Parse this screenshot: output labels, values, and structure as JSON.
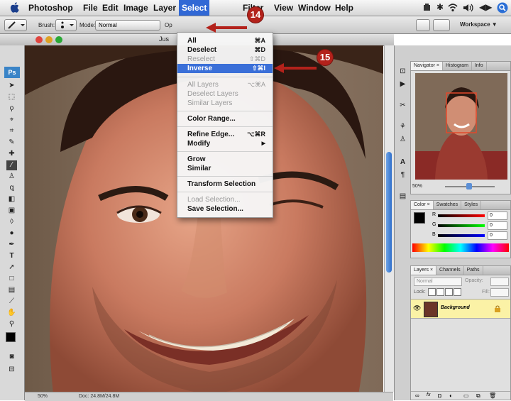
{
  "menubar": {
    "app_name": "Photoshop",
    "items": [
      "File",
      "Edit",
      "Image",
      "Layer",
      "Select",
      "Filter",
      "View",
      "Window",
      "Help"
    ]
  },
  "options_bar": {
    "brush_label": "Brush:",
    "mode_label": "Mode:",
    "mode_value": "Normal",
    "opacity_label": "Op",
    "workspace_label": "Workspace ▼"
  },
  "document": {
    "title": "Jus"
  },
  "select_menu": {
    "items": [
      {
        "label": "All",
        "shortcut": "⌘A",
        "disabled": false,
        "highlighted": false
      },
      {
        "label": "Deselect",
        "shortcut": "⌘D",
        "disabled": false,
        "highlighted": false
      },
      {
        "label": "Reselect",
        "shortcut": "⇧⌘D",
        "disabled": true,
        "highlighted": false
      },
      {
        "label": "Inverse",
        "shortcut": "⇧⌘I",
        "disabled": false,
        "highlighted": true
      },
      {
        "label": "All Layers",
        "shortcut": "⌥⌘A",
        "disabled": true,
        "highlighted": false
      },
      {
        "label": "Deselect Layers",
        "shortcut": "",
        "disabled": true,
        "highlighted": false
      },
      {
        "label": "Similar Layers",
        "shortcut": "",
        "disabled": true,
        "highlighted": false
      },
      {
        "label": "Color Range...",
        "shortcut": "",
        "disabled": false,
        "highlighted": false
      },
      {
        "label": "Refine Edge...",
        "shortcut": "⌥⌘R",
        "disabled": false,
        "highlighted": false
      },
      {
        "label": "Modify",
        "shortcut": "▶",
        "disabled": false,
        "highlighted": false
      },
      {
        "label": "Grow",
        "shortcut": "",
        "disabled": false,
        "highlighted": false
      },
      {
        "label": "Similar",
        "shortcut": "",
        "disabled": false,
        "highlighted": false
      },
      {
        "label": "Transform Selection",
        "shortcut": "",
        "disabled": false,
        "highlighted": false
      },
      {
        "label": "Load Selection...",
        "shortcut": "",
        "disabled": true,
        "highlighted": false
      },
      {
        "label": "Save Selection...",
        "shortcut": "",
        "disabled": false,
        "highlighted": false
      }
    ]
  },
  "callouts": {
    "step1": "14",
    "step2": "15"
  },
  "navigator_panel": {
    "tabs": [
      "Navigator ×",
      "Histogram",
      "Info"
    ],
    "zoom": "50%"
  },
  "color_panel": {
    "tabs": [
      "Color ×",
      "Swatches",
      "Styles"
    ],
    "channels": [
      {
        "label": "R",
        "value": "0"
      },
      {
        "label": "G",
        "value": "0"
      },
      {
        "label": "B",
        "value": "0"
      }
    ]
  },
  "layers_panel": {
    "tabs": [
      "Layers ×",
      "Channels",
      "Paths"
    ],
    "blend_mode": "Normal",
    "opacity_label": "Opacity:",
    "lock_label": "Lock:",
    "fill_label": "Fill:",
    "layer_name": "Background"
  },
  "status_bar": {
    "zoom": "50%",
    "doc_info": "Doc: 24.8M/24.8M"
  },
  "colors": {
    "menu_highlight": "#3a6fd8",
    "callout_red": "#b3221b",
    "layer_highlight": "#fbf2a6"
  },
  "icons": [
    "apple-icon",
    "brush-tool-icon",
    "search-icon",
    "wifi-icon",
    "volume-icon",
    "battery-icon",
    "eye-icon",
    "lock-icon",
    "chain-link-icon",
    "trash-icon"
  ]
}
